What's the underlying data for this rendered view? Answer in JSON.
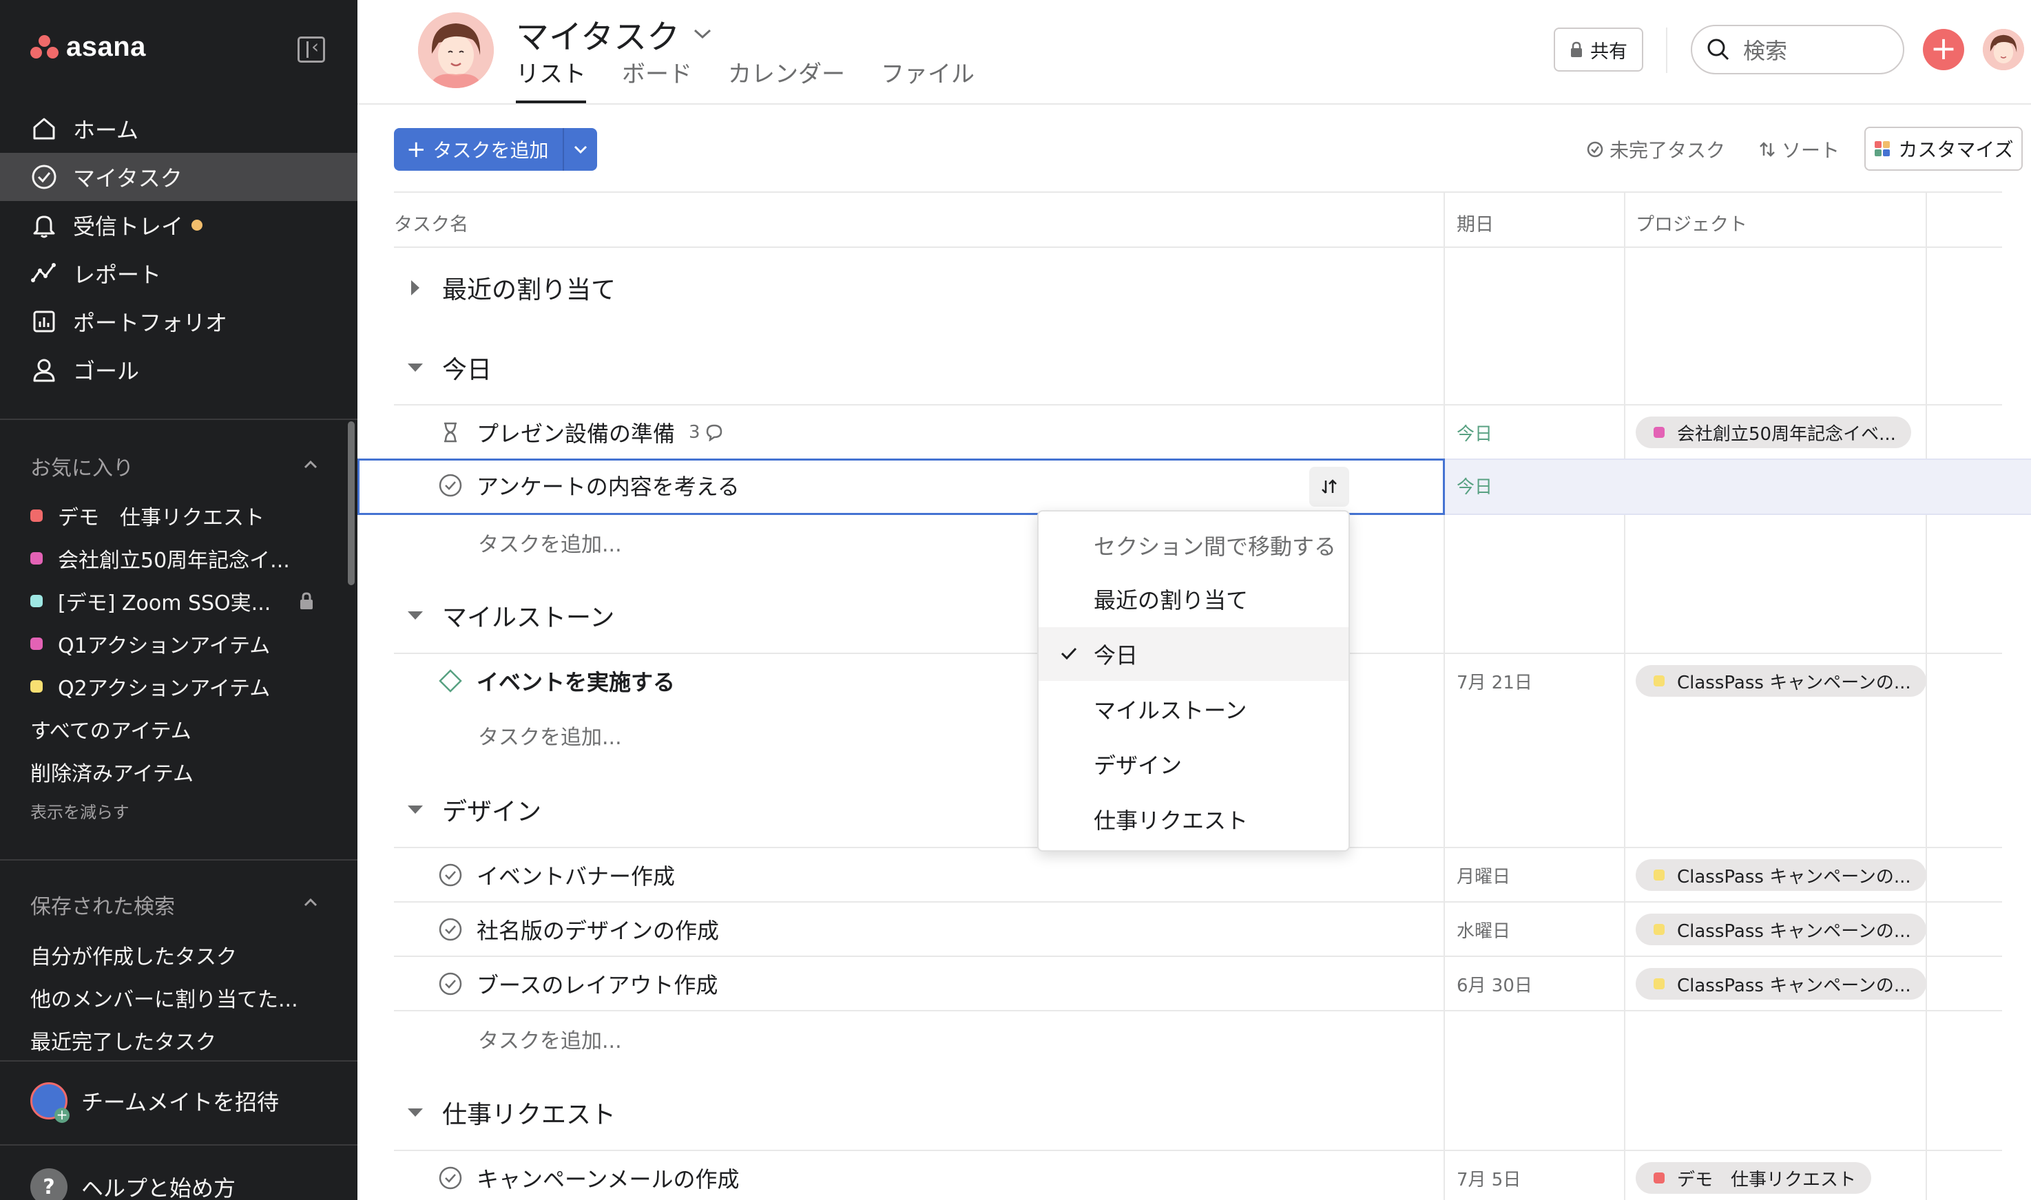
{
  "sidebar": {
    "logo_text": "asana",
    "nav": [
      {
        "label": "ホーム",
        "icon": "home-icon"
      },
      {
        "label": "マイタスク",
        "icon": "check-circle-icon",
        "active": true
      },
      {
        "label": "受信トレイ",
        "icon": "bell-icon",
        "badge": true
      },
      {
        "label": "レポート",
        "icon": "trend-line-icon"
      },
      {
        "label": "ポートフォリオ",
        "icon": "bar-chart-icon"
      },
      {
        "label": "ゴール",
        "icon": "person-icon"
      }
    ],
    "favorites_title": "お気に入り",
    "favorites": [
      {
        "label": "デモ　仕事リクエスト",
        "color": "#f06a6a"
      },
      {
        "label": "会社創立50周年記念イ...",
        "color": "#e362b5"
      },
      {
        "label": "[デモ] Zoom SSO実...",
        "color": "#9ee7e3",
        "locked": true
      },
      {
        "label": "Q1アクションアイテム",
        "color": "#e362b5"
      },
      {
        "label": "Q2アクションアイテム",
        "color": "#f8df72"
      }
    ],
    "all_items": "すべてのアイテム",
    "deleted_items": "削除済みアイテム",
    "show_less": "表示を減らす",
    "saved_search_title": "保存された検索",
    "saved_searches": [
      "自分が作成したタスク",
      "他のメンバーに割り当てた...",
      "最近完了したタスク"
    ],
    "invite": "チームメイトを招待",
    "help": "ヘルプと始め方"
  },
  "header": {
    "title": "マイタスク",
    "tabs": [
      "リスト",
      "ボード",
      "カレンダー",
      "ファイル"
    ],
    "active_tab": "リスト",
    "share": "共有",
    "search_placeholder": "検索"
  },
  "toolbar": {
    "add_task": "タスクを追加",
    "incomplete": "未完了タスク",
    "sort": "ソート",
    "customize": "カスタマイズ"
  },
  "table": {
    "col_name": "タスク名",
    "col_due": "期日",
    "col_project": "プロジェクト",
    "add_task_inline": "タスクを追加...",
    "sections": {
      "recent": "最近の割り当て",
      "today": "今日",
      "milestones": "マイルストーン",
      "design": "デザイン",
      "requests": "仕事リクエスト"
    },
    "today_tasks": [
      {
        "name": "プレゼン設備の準備",
        "comments": "3",
        "due": "今日",
        "project": "会社創立50周年記念イベ...",
        "project_color": "#e362b5"
      },
      {
        "name": "アンケートの内容を考える",
        "due": "今日",
        "project": ""
      }
    ],
    "milestone_tasks": [
      {
        "name": "イベントを実施する",
        "due": "7月 21日",
        "project": "ClassPass キャンペーンの...",
        "project_color": "#f8df72"
      }
    ],
    "design_tasks": [
      {
        "name": "イベントバナー作成",
        "due": "月曜日",
        "project": "ClassPass キャンペーンの...",
        "project_color": "#f8df72"
      },
      {
        "name": "社名版のデザインの作成",
        "due": "水曜日",
        "project": "ClassPass キャンペーンの...",
        "project_color": "#f8df72"
      },
      {
        "name": "ブースのレイアウト作成",
        "due": "6月 30日",
        "project": "ClassPass キャンペーンの...",
        "project_color": "#f8df72"
      }
    ],
    "request_tasks": [
      {
        "name": "キャンペーンメールの作成",
        "due": "7月 5日",
        "project": "デモ　仕事リクエスト",
        "project_color": "#f06a6a"
      }
    ]
  },
  "move_menu": {
    "title": "セクション間で移動する",
    "options": [
      "最近の割り当て",
      "今日",
      "マイルストーン",
      "デザイン",
      "仕事リクエスト"
    ],
    "selected": "今日"
  }
}
